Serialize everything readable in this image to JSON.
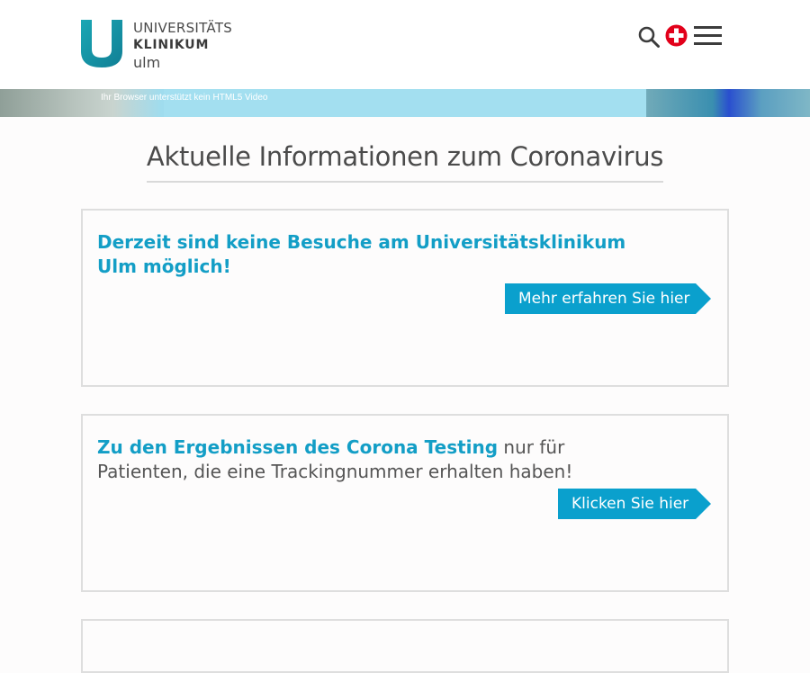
{
  "header": {
    "logo": {
      "line1": "UNIVERSITÄTS",
      "line2": "KLINIKUM",
      "line3": "ulm"
    },
    "icons": [
      "search-icon",
      "emergency-cross-icon",
      "hamburger-menu-icon"
    ],
    "colors": {
      "brand_teal": "#1c9fb1",
      "accent_red": "#e2001a"
    }
  },
  "video": {
    "fallback_message": "Ihr Browser unterstützt kein HTML5 Video"
  },
  "main": {
    "title": "Aktuelle Informationen zum Coronavirus",
    "cards": [
      {
        "highlight": "Derzeit sind keine Besuche am Universitätsklinikum Ulm möglich!",
        "text": "",
        "button_label": "Mehr erfahren Sie hier"
      },
      {
        "highlight": "Zu den Ergebnissen des Corona Testing",
        "text": " nur für Patienten, die eine Trackingnummer erhalten haben!",
        "button_label": "Klicken Sie hier"
      }
    ],
    "colors": {
      "link_blue": "#139ec6",
      "button_blue": "#0aa0cd"
    }
  }
}
